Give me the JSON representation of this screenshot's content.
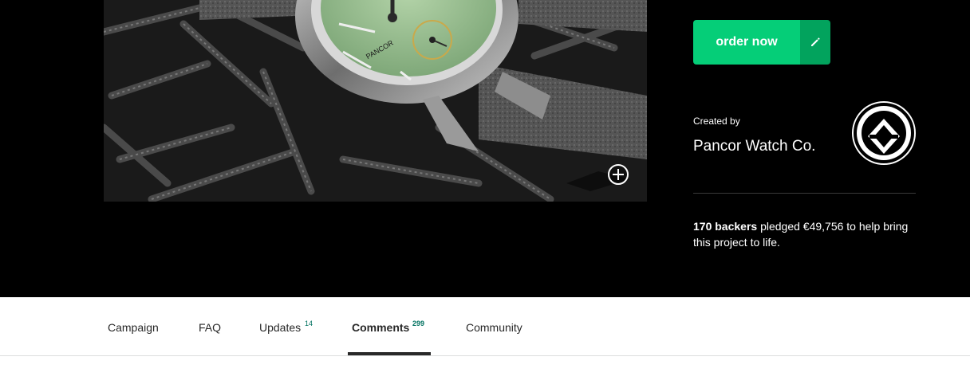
{
  "order": {
    "label": "order now"
  },
  "creator": {
    "created_by_label": "Created by",
    "name": "Pancor Watch Co."
  },
  "pledge": {
    "backers": "170 backers",
    "text": "pledged €49,756 to help bring this project to life."
  },
  "image": {
    "brand_on_dial": "PANCOR"
  },
  "tabs": [
    {
      "label": "Campaign",
      "count": ""
    },
    {
      "label": "FAQ",
      "count": ""
    },
    {
      "label": "Updates",
      "count": "14"
    },
    {
      "label": "Comments",
      "count": "299"
    },
    {
      "label": "Community",
      "count": ""
    }
  ],
  "colors": {
    "accent": "#05ce78",
    "accent_dark": "#02a35d",
    "count": "#037362"
  }
}
